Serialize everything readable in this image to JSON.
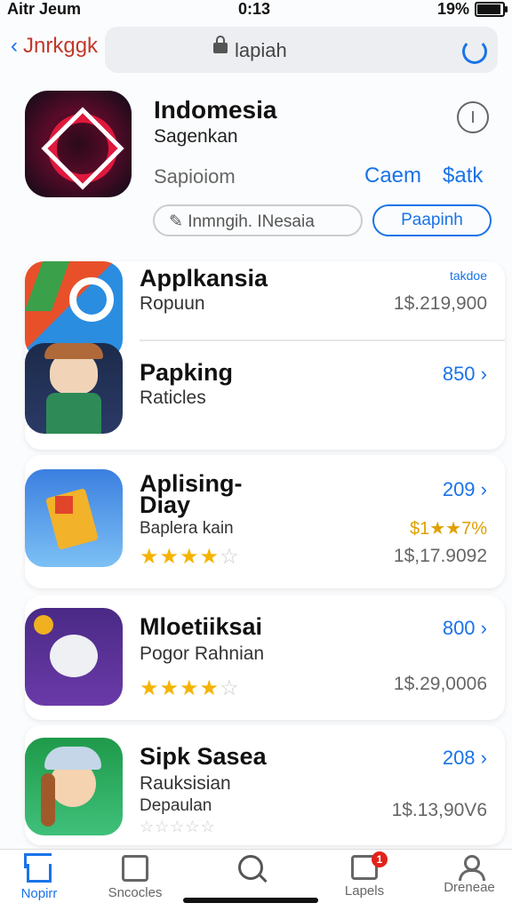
{
  "status": {
    "carrier": "Aitr Jeum",
    "time": "0:13",
    "battery": "19%"
  },
  "nav": {
    "back_label": "Jnrkggk",
    "url": "lapiah"
  },
  "hero": {
    "title": "Indomesia",
    "subtitle": "Sagenkan",
    "meta": "Sapioiom",
    "action1": "Caem",
    "action2": "$atk",
    "info_label": "I",
    "search_pill": "Inmngih. INesaia",
    "get_pill": "Paapinh"
  },
  "apps": [
    {
      "title": "Applkansia",
      "subtitle": "Ropuun",
      "price": "1$.219,900",
      "tag": "takdoe"
    },
    {
      "title": "Papking",
      "subtitle": "Raticles",
      "number": "850"
    },
    {
      "title": "Aplising-Diay",
      "subtitle": "Baplera kain",
      "number": "209",
      "price": "1$,17.9092",
      "percent": "$1★★7%",
      "rating": 4
    },
    {
      "title": "Mloetiiksai",
      "subtitle": "Pogor Rahnian",
      "number": "800",
      "price": "1$.29,0006",
      "rating": 4
    },
    {
      "title": "Sipk Sasea",
      "subtitle": "Rauksisian",
      "subtitle2": "Depaulan",
      "number": "208",
      "price": "1$.13,90V6",
      "rating": 0
    }
  ],
  "tabs": [
    {
      "label": "Nopirr",
      "icon": "home-icon"
    },
    {
      "label": "Sncocles",
      "icon": "box-icon"
    },
    {
      "label": "",
      "icon": "search-icon"
    },
    {
      "label": "Lapels",
      "icon": "message-icon",
      "badge": "1"
    },
    {
      "label": "Dreneae",
      "icon": "person-icon"
    }
  ],
  "colors": {
    "accent": "#1a73e8",
    "star": "#f5b300",
    "badge": "#e2231a"
  }
}
